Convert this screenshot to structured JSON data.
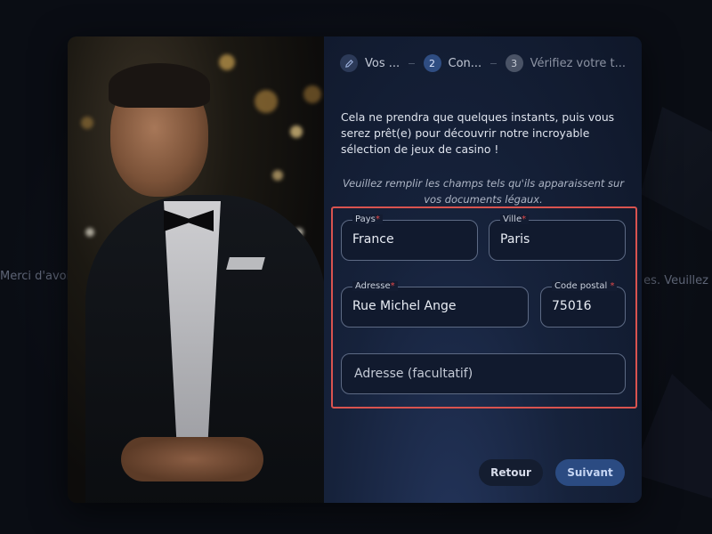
{
  "background": {
    "left_text": "Merci d'avoir patienter...",
    "right_text": "es. Veuillez"
  },
  "stepper": {
    "steps": [
      {
        "badge": "✎",
        "icon": "pencil-icon",
        "label": "Vos ...",
        "state": "done"
      },
      {
        "badge": "2",
        "label": "Con...",
        "state": "active"
      },
      {
        "badge": "3",
        "label": "Vérifiez votre t...",
        "state": "todo"
      }
    ]
  },
  "intro_text": "Cela ne prendra que quelques instants, puis vous serez prêt(e) pour découvrir notre incroyable sélection de jeux de casino !",
  "note_text": "Veuillez remplir les champs tels qu'ils apparaissent sur vos documents légaux.",
  "form": {
    "pays": {
      "label": "Pays",
      "required": "*",
      "value": "France"
    },
    "ville": {
      "label": "Ville",
      "required": "*",
      "value": "Paris"
    },
    "adresse": {
      "label": "Adresse",
      "required": "*",
      "value": "Rue Michel Ange"
    },
    "code_postal": {
      "label": "Code postal",
      "required": "*",
      "value": "75016"
    },
    "adresse2": {
      "placeholder": "Adresse (facultatif)"
    }
  },
  "buttons": {
    "retour": "Retour",
    "suivant": "Suivant"
  },
  "colors": {
    "highlight": "#d9534f",
    "primary_button": "#2b4b82",
    "required": "#e0494b"
  }
}
